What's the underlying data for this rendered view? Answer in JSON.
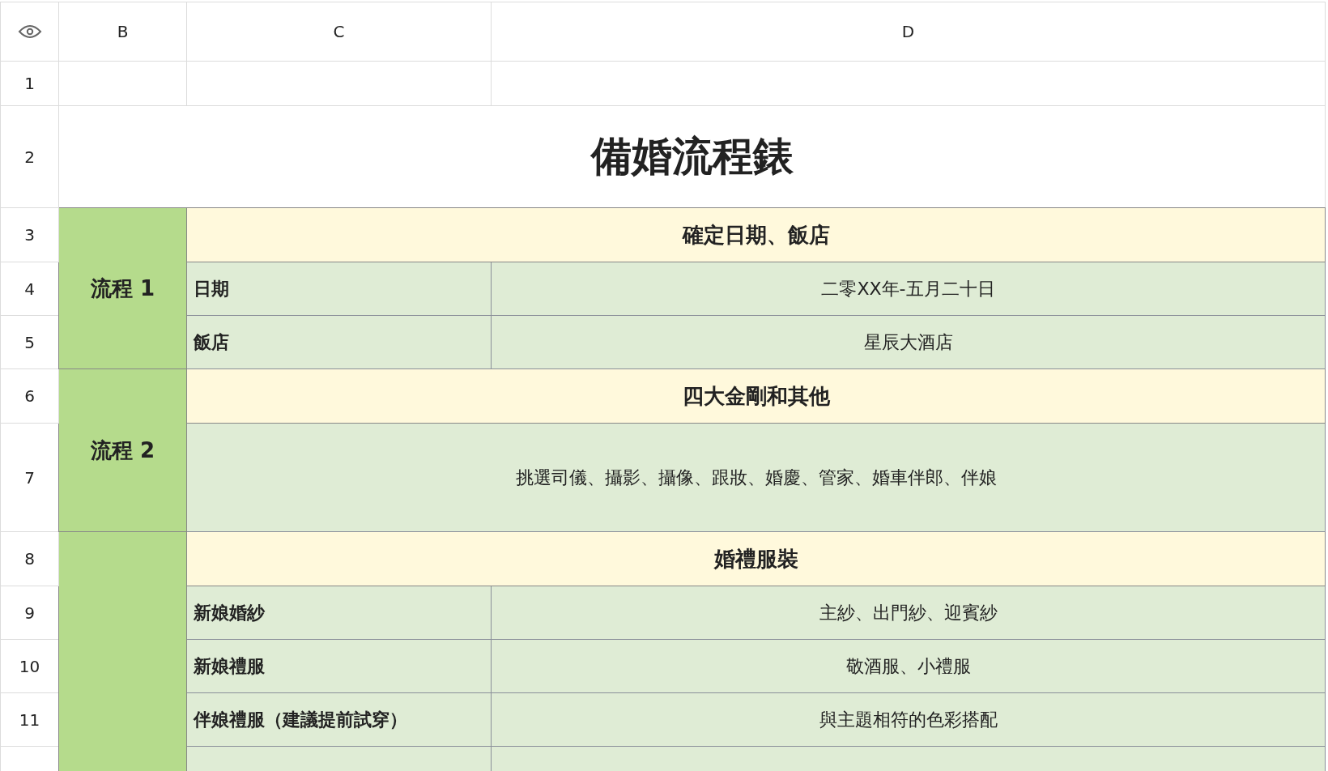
{
  "column_headers": [
    "B",
    "C",
    "D"
  ],
  "row_numbers": [
    "1",
    "2",
    "3",
    "4",
    "5",
    "6",
    "7",
    "8",
    "9",
    "10",
    "11"
  ],
  "title": "備婚流程錶",
  "sections": [
    {
      "label": "流程 1",
      "heading": "確定日期、飯店",
      "items": [
        {
          "kind": "pair",
          "name": "日期",
          "value": "二零XX年-五月二十日"
        },
        {
          "kind": "pair",
          "name": "飯店",
          "value": "星辰大酒店"
        }
      ]
    },
    {
      "label": "流程 2",
      "heading": "四大金剛和其他",
      "items": [
        {
          "kind": "note",
          "text": "挑選司儀、攝影、攝像、跟妝、婚慶、管家、婚車伴郎、伴娘"
        }
      ]
    },
    {
      "heading": "婚禮服裝",
      "items": [
        {
          "kind": "pair",
          "name": "新娘婚紗",
          "value": "主紗、出門紗、迎賓紗"
        },
        {
          "kind": "pair",
          "name": "新娘禮服",
          "value": "敬酒服、小禮服"
        },
        {
          "kind": "pair",
          "name": "伴娘禮服（建議提前試穿）",
          "value": "與主題相符的色彩搭配"
        }
      ]
    }
  ]
}
